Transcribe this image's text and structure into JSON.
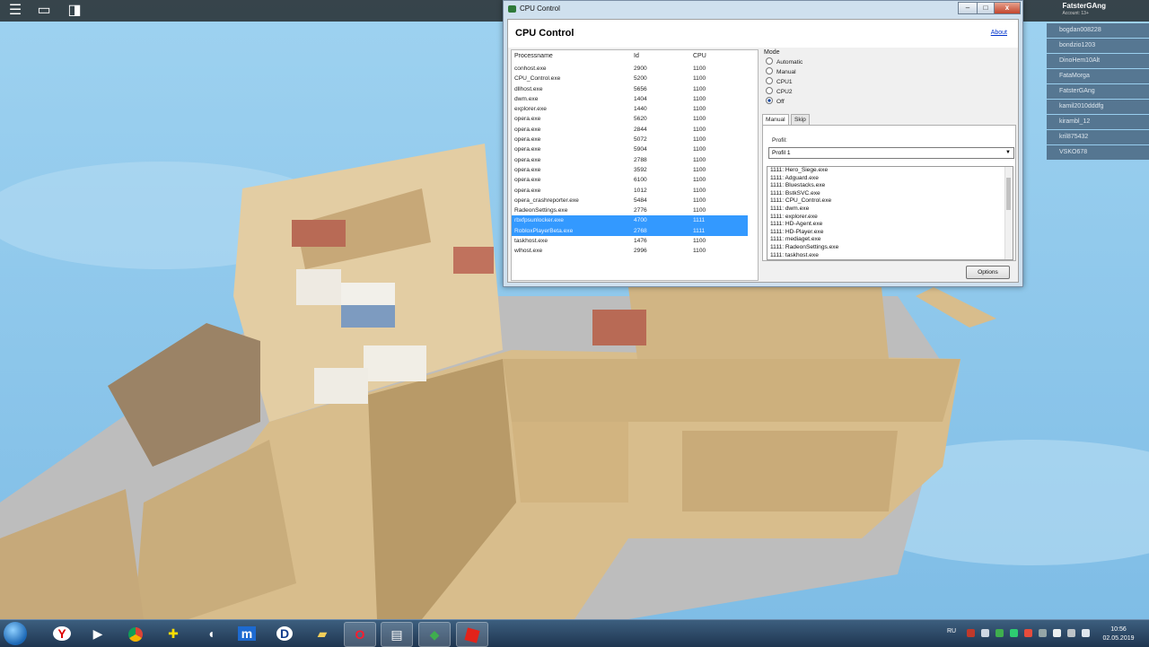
{
  "window": {
    "title": "CPU Control",
    "app_title": "CPU Control",
    "about_link": "About",
    "buttons": {
      "minimize": "–",
      "maximize": "□",
      "close": "x"
    }
  },
  "process_list": {
    "columns": [
      "Processname",
      "Id",
      "CPU"
    ],
    "rows": [
      {
        "name": "conhost.exe",
        "id": "2900",
        "cpu": "1100"
      },
      {
        "name": "CPU_Control.exe",
        "id": "5200",
        "cpu": "1100"
      },
      {
        "name": "dllhost.exe",
        "id": "5656",
        "cpu": "1100"
      },
      {
        "name": "dwm.exe",
        "id": "1404",
        "cpu": "1100"
      },
      {
        "name": "explorer.exe",
        "id": "1440",
        "cpu": "1100"
      },
      {
        "name": "opera.exe",
        "id": "5620",
        "cpu": "1100"
      },
      {
        "name": "opera.exe",
        "id": "2844",
        "cpu": "1100"
      },
      {
        "name": "opera.exe",
        "id": "5072",
        "cpu": "1100"
      },
      {
        "name": "opera.exe",
        "id": "5904",
        "cpu": "1100"
      },
      {
        "name": "opera.exe",
        "id": "2788",
        "cpu": "1100"
      },
      {
        "name": "opera.exe",
        "id": "3592",
        "cpu": "1100"
      },
      {
        "name": "opera.exe",
        "id": "6100",
        "cpu": "1100"
      },
      {
        "name": "opera.exe",
        "id": "1012",
        "cpu": "1100"
      },
      {
        "name": "opera_crashreporter.exe",
        "id": "5484",
        "cpu": "1100"
      },
      {
        "name": "RadeonSettings.exe",
        "id": "2776",
        "cpu": "1100"
      },
      {
        "name": "rbxfpsunlocker.exe",
        "id": "4700",
        "cpu": "1111",
        "selected": true
      },
      {
        "name": "RobloxPlayerBeta.exe",
        "id": "2768",
        "cpu": "1111",
        "selected": true
      },
      {
        "name": "taskhost.exe",
        "id": "1476",
        "cpu": "1100"
      },
      {
        "name": "wlhost.exe",
        "id": "2996",
        "cpu": "1100"
      }
    ]
  },
  "mode": {
    "label": "Mode",
    "options": [
      "Automatic",
      "Manual",
      "CPU1",
      "CPU2",
      "Off"
    ],
    "selected": "Off"
  },
  "tabs": [
    "Manual",
    "Skip"
  ],
  "manual": {
    "profile_label": "Profil:",
    "profile_value": "Profil 1",
    "rules": [
      "1111: Hero_Siege.exe",
      "1111: Adguard.exe",
      "1111: Bluestacks.exe",
      "1111: BstkSVC.exe",
      "1111: CPU_Control.exe",
      "1111: dwm.exe",
      "1111: explorer.exe",
      "1111: HD-Agent.exe",
      "1111: HD-Player.exe",
      "1111: mediaget.exe",
      "1111: RadeonSettings.exe",
      "1111: taskhost.exe"
    ]
  },
  "options_button": "Options",
  "roblox": {
    "account_name": "FatsterGAng",
    "account_sub": "Account: 13+",
    "players": [
      "bogdan008228",
      "bondzio1203",
      "DinoHem10Alt",
      "FataMorga",
      "FatsterGAng",
      "kamil2010dddfg",
      "kirambl_12",
      "kril875432",
      "VSKO678"
    ]
  },
  "taskbar": {
    "language": "RU",
    "time": "10:56",
    "date": "02.05.2019"
  },
  "colors": {
    "selection": "#3399ff",
    "sky": "#8ec6ea",
    "sand": "#d9bf8f"
  }
}
